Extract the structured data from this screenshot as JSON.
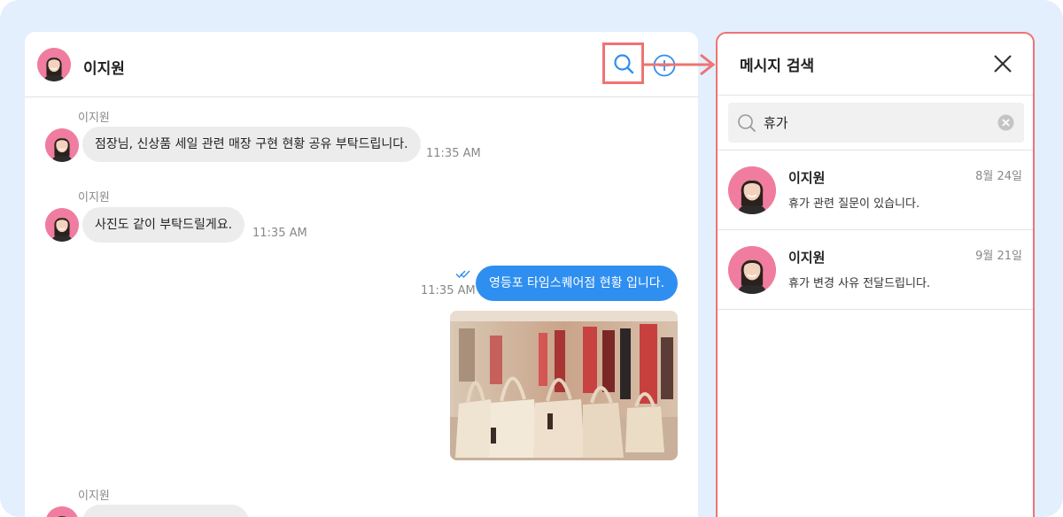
{
  "chat": {
    "contact_name": "이지원",
    "messages": [
      {
        "sender": "이지원",
        "text": "점장님, 신상품 세일 관련 매장 구현 현황 공유 부탁드립니다.",
        "time": "11:35 AM"
      },
      {
        "sender": "이지원",
        "text": "사진도 같이 부탁드릴게요.",
        "time": "11:35 AM"
      },
      {
        "text": "영등포 타임스퀘어점 현황 입니다.",
        "time": "11:35 AM"
      },
      {
        "sender": "이지원"
      }
    ]
  },
  "search_panel": {
    "title": "메시지 검색",
    "query": "휴가",
    "results": [
      {
        "name": "이지원",
        "date": "8월 24일",
        "snippet": "휴가 관련 질문이 있습니다."
      },
      {
        "name": "이지원",
        "date": "9월 21일",
        "snippet": "휴가 변경 사유 전달드립니다."
      }
    ]
  },
  "colors": {
    "background": "#e3effc",
    "accent_blue": "#2f8ff0",
    "highlight_red": "#ef7373",
    "avatar_pink": "#f07da0"
  },
  "icons": [
    "search-icon",
    "add-circle-icon",
    "arrow-right-icon",
    "close-icon",
    "clear-icon",
    "double-check-icon"
  ]
}
